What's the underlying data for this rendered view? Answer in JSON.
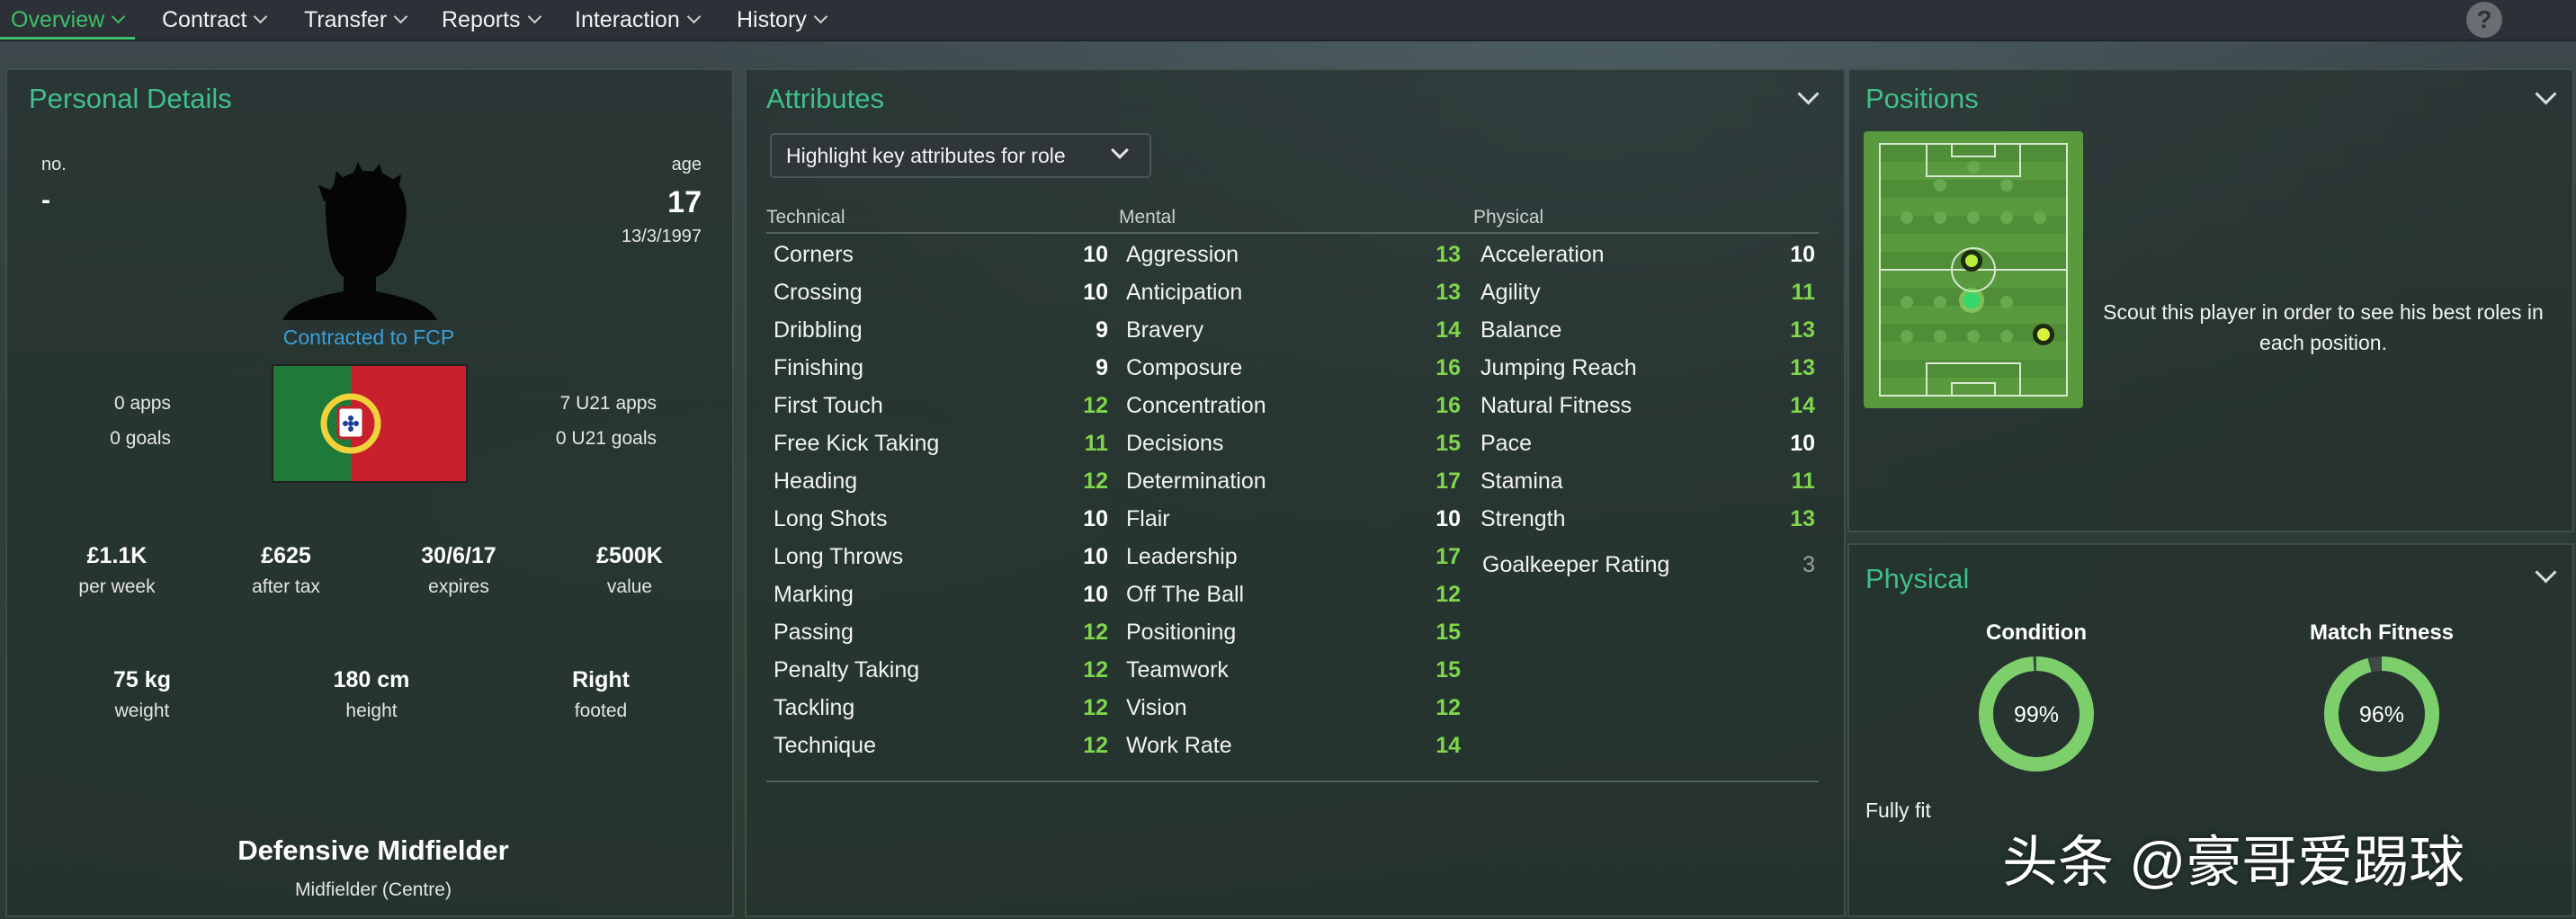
{
  "nav": {
    "tabs": [
      {
        "label": "Overview"
      },
      {
        "label": "Contract"
      },
      {
        "label": "Transfer"
      },
      {
        "label": "Reports"
      },
      {
        "label": "Interaction"
      },
      {
        "label": "History"
      }
    ],
    "active_tab": "Overview",
    "help_label": "?"
  },
  "personal": {
    "title": "Personal Details",
    "number_label": "no.",
    "number_value": "-",
    "age_label": "age",
    "age_value": "17",
    "dob": "13/3/1997",
    "contract_status": "Contracted to FCP",
    "apps": "0 apps",
    "goals": "0 goals",
    "u21_apps": "7 U21 apps",
    "u21_goals": "0 U21 goals",
    "stats": [
      {
        "value": "£1.1K",
        "label": "per week"
      },
      {
        "value": "£625",
        "label": "after tax"
      },
      {
        "value": "30/6/17",
        "label": "expires"
      },
      {
        "value": "£500K",
        "label": "value"
      }
    ],
    "body": [
      {
        "value": "75 kg",
        "label": "weight"
      },
      {
        "value": "180 cm",
        "label": "height"
      },
      {
        "value": "Right",
        "label": "footed"
      }
    ],
    "position_main": "Defensive Midfielder",
    "position_sub": "Midfielder (Centre)",
    "flag_colors": {
      "green": "#1f7a3a",
      "red": "#c8202d",
      "emblem": "#f2d13a"
    }
  },
  "attributes": {
    "title": "Attributes",
    "highlight_dropdown": "Highlight key attributes for role",
    "technical": {
      "heading": "Technical",
      "items": [
        {
          "name": "Corners",
          "value": "10"
        },
        {
          "name": "Crossing",
          "value": "10"
        },
        {
          "name": "Dribbling",
          "value": "9"
        },
        {
          "name": "Finishing",
          "value": "9"
        },
        {
          "name": "First Touch",
          "value": "12"
        },
        {
          "name": "Free Kick Taking",
          "value": "11"
        },
        {
          "name": "Heading",
          "value": "12"
        },
        {
          "name": "Long Shots",
          "value": "10"
        },
        {
          "name": "Long Throws",
          "value": "10"
        },
        {
          "name": "Marking",
          "value": "10"
        },
        {
          "name": "Passing",
          "value": "12"
        },
        {
          "name": "Penalty Taking",
          "value": "12"
        },
        {
          "name": "Tackling",
          "value": "12"
        },
        {
          "name": "Technique",
          "value": "12"
        }
      ]
    },
    "mental": {
      "heading": "Mental",
      "items": [
        {
          "name": "Aggression",
          "value": "13"
        },
        {
          "name": "Anticipation",
          "value": "13"
        },
        {
          "name": "Bravery",
          "value": "14"
        },
        {
          "name": "Composure",
          "value": "16"
        },
        {
          "name": "Concentration",
          "value": "16"
        },
        {
          "name": "Decisions",
          "value": "15"
        },
        {
          "name": "Determination",
          "value": "17"
        },
        {
          "name": "Flair",
          "value": "10"
        },
        {
          "name": "Leadership",
          "value": "17"
        },
        {
          "name": "Off The Ball",
          "value": "12"
        },
        {
          "name": "Positioning",
          "value": "15"
        },
        {
          "name": "Teamwork",
          "value": "15"
        },
        {
          "name": "Vision",
          "value": "12"
        },
        {
          "name": "Work Rate",
          "value": "14"
        }
      ]
    },
    "physical": {
      "heading": "Physical",
      "items": [
        {
          "name": "Acceleration",
          "value": "10"
        },
        {
          "name": "Agility",
          "value": "11"
        },
        {
          "name": "Balance",
          "value": "13"
        },
        {
          "name": "Jumping Reach",
          "value": "13"
        },
        {
          "name": "Natural Fitness",
          "value": "14"
        },
        {
          "name": "Pace",
          "value": "10"
        },
        {
          "name": "Stamina",
          "value": "11"
        },
        {
          "name": "Strength",
          "value": "13"
        }
      ],
      "goalkeeper_label": "Goalkeeper Rating",
      "goalkeeper_value": "3"
    }
  },
  "positions": {
    "title": "Positions",
    "scout_message": "Scout this player in order to see his best roles in each position."
  },
  "physical_panel": {
    "title": "Physical",
    "condition_label": "Condition",
    "condition_value": "99%",
    "condition_fraction": 0.99,
    "fitness_label": "Match Fitness",
    "fitness_value": "96%",
    "fitness_fraction": 0.96,
    "status_text": "Fully fit",
    "ring_color": "#7ccf6a"
  },
  "watermark": "头条 @豪哥爱踢球"
}
